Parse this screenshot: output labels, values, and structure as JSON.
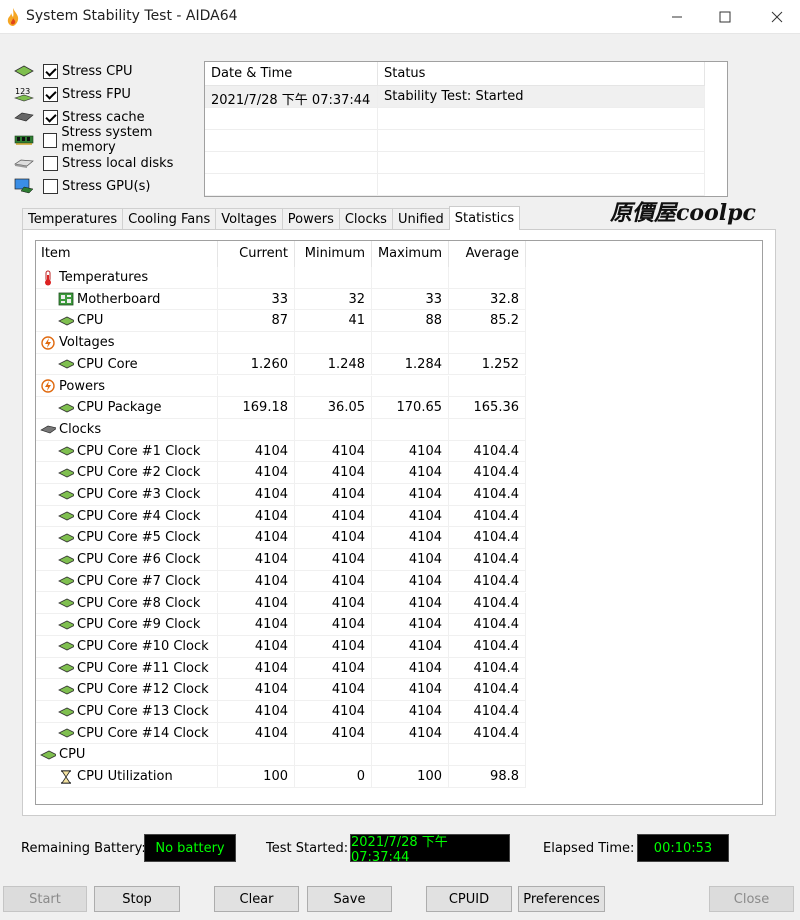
{
  "window": {
    "title": "System Stability Test - AIDA64"
  },
  "stress": [
    {
      "label": "Stress CPU",
      "checked": true,
      "icon": "cpu-chip-icon"
    },
    {
      "label": "Stress FPU",
      "checked": true,
      "icon": "fpu-123-icon"
    },
    {
      "label": "Stress cache",
      "checked": true,
      "icon": "cache-module-icon"
    },
    {
      "label": "Stress system memory",
      "checked": false,
      "icon": "memory-ram-icon"
    },
    {
      "label": "Stress local disks",
      "checked": false,
      "icon": "disk-drive-icon"
    },
    {
      "label": "Stress GPU(s)",
      "checked": false,
      "icon": "gpu-monitor-icon"
    }
  ],
  "log": {
    "headers": [
      "Date & Time",
      "Status"
    ],
    "rows": [
      {
        "datetime": "2021/7/28 下午 07:37:44",
        "status": "Stability Test: Started"
      }
    ]
  },
  "tabs": [
    "Temperatures",
    "Cooling Fans",
    "Voltages",
    "Powers",
    "Clocks",
    "Unified",
    "Statistics"
  ],
  "active_tab": "Statistics",
  "brand": {
    "text": "原價屋coolpc"
  },
  "grid": {
    "headers": [
      "Item",
      "Current",
      "Minimum",
      "Maximum",
      "Average"
    ],
    "rows": [
      {
        "label": "Temperatures",
        "level": 0,
        "icon": "thermometer-icon",
        "cur": "",
        "min": "",
        "max": "",
        "avg": ""
      },
      {
        "label": "Motherboard",
        "level": 1,
        "icon": "motherboard-icon",
        "cur": "33",
        "min": "32",
        "max": "33",
        "avg": "32.8"
      },
      {
        "label": "CPU",
        "level": 1,
        "icon": "cpu-chip-icon",
        "cur": "87",
        "min": "41",
        "max": "88",
        "avg": "85.2"
      },
      {
        "label": "Voltages",
        "level": 0,
        "icon": "voltage-icon",
        "cur": "",
        "min": "",
        "max": "",
        "avg": ""
      },
      {
        "label": "CPU Core",
        "level": 1,
        "icon": "cpu-chip-icon",
        "cur": "1.260",
        "min": "1.248",
        "max": "1.284",
        "avg": "1.252"
      },
      {
        "label": "Powers",
        "level": 0,
        "icon": "power-icon",
        "cur": "",
        "min": "",
        "max": "",
        "avg": ""
      },
      {
        "label": "CPU Package",
        "level": 1,
        "icon": "cpu-chip-icon",
        "cur": "169.18",
        "min": "36.05",
        "max": "170.65",
        "avg": "165.36"
      },
      {
        "label": "Clocks",
        "level": 0,
        "icon": "clock-chip-icon",
        "cur": "",
        "min": "",
        "max": "",
        "avg": ""
      },
      {
        "label": "CPU Core #1 Clock",
        "level": 1,
        "icon": "cpu-chip-icon",
        "cur": "4104",
        "min": "4104",
        "max": "4104",
        "avg": "4104.4"
      },
      {
        "label": "CPU Core #2 Clock",
        "level": 1,
        "icon": "cpu-chip-icon",
        "cur": "4104",
        "min": "4104",
        "max": "4104",
        "avg": "4104.4"
      },
      {
        "label": "CPU Core #3 Clock",
        "level": 1,
        "icon": "cpu-chip-icon",
        "cur": "4104",
        "min": "4104",
        "max": "4104",
        "avg": "4104.4"
      },
      {
        "label": "CPU Core #4 Clock",
        "level": 1,
        "icon": "cpu-chip-icon",
        "cur": "4104",
        "min": "4104",
        "max": "4104",
        "avg": "4104.4"
      },
      {
        "label": "CPU Core #5 Clock",
        "level": 1,
        "icon": "cpu-chip-icon",
        "cur": "4104",
        "min": "4104",
        "max": "4104",
        "avg": "4104.4"
      },
      {
        "label": "CPU Core #6 Clock",
        "level": 1,
        "icon": "cpu-chip-icon",
        "cur": "4104",
        "min": "4104",
        "max": "4104",
        "avg": "4104.4"
      },
      {
        "label": "CPU Core #7 Clock",
        "level": 1,
        "icon": "cpu-chip-icon",
        "cur": "4104",
        "min": "4104",
        "max": "4104",
        "avg": "4104.4"
      },
      {
        "label": "CPU Core #8 Clock",
        "level": 1,
        "icon": "cpu-chip-icon",
        "cur": "4104",
        "min": "4104",
        "max": "4104",
        "avg": "4104.4"
      },
      {
        "label": "CPU Core #9 Clock",
        "level": 1,
        "icon": "cpu-chip-icon",
        "cur": "4104",
        "min": "4104",
        "max": "4104",
        "avg": "4104.4"
      },
      {
        "label": "CPU Core #10 Clock",
        "level": 1,
        "icon": "cpu-chip-icon",
        "cur": "4104",
        "min": "4104",
        "max": "4104",
        "avg": "4104.4"
      },
      {
        "label": "CPU Core #11 Clock",
        "level": 1,
        "icon": "cpu-chip-icon",
        "cur": "4104",
        "min": "4104",
        "max": "4104",
        "avg": "4104.4"
      },
      {
        "label": "CPU Core #12 Clock",
        "level": 1,
        "icon": "cpu-chip-icon",
        "cur": "4104",
        "min": "4104",
        "max": "4104",
        "avg": "4104.4"
      },
      {
        "label": "CPU Core #13 Clock",
        "level": 1,
        "icon": "cpu-chip-icon",
        "cur": "4104",
        "min": "4104",
        "max": "4104",
        "avg": "4104.4"
      },
      {
        "label": "CPU Core #14 Clock",
        "level": 1,
        "icon": "cpu-chip-icon",
        "cur": "4104",
        "min": "4104",
        "max": "4104",
        "avg": "4104.4"
      },
      {
        "label": "CPU",
        "level": 0,
        "icon": "cpu-chip-icon",
        "cur": "",
        "min": "",
        "max": "",
        "avg": ""
      },
      {
        "label": "CPU Utilization",
        "level": 1,
        "icon": "hourglass-icon",
        "cur": "100",
        "min": "0",
        "max": "100",
        "avg": "98.8"
      }
    ]
  },
  "status": {
    "battery_label": "Remaining Battery:",
    "battery_value": "No battery",
    "started_label": "Test Started:",
    "started_value": "2021/7/28 下午 07:37:44",
    "elapsed_label": "Elapsed Time:",
    "elapsed_value": "00:10:53"
  },
  "buttons": {
    "start": "Start",
    "stop": "Stop",
    "clear": "Clear",
    "save": "Save",
    "cpuid": "CPUID",
    "preferences": "Preferences",
    "close": "Close"
  },
  "colors": {
    "led_bg": "#000000",
    "led_text": "#00ff00",
    "flame": "#f5a623"
  }
}
